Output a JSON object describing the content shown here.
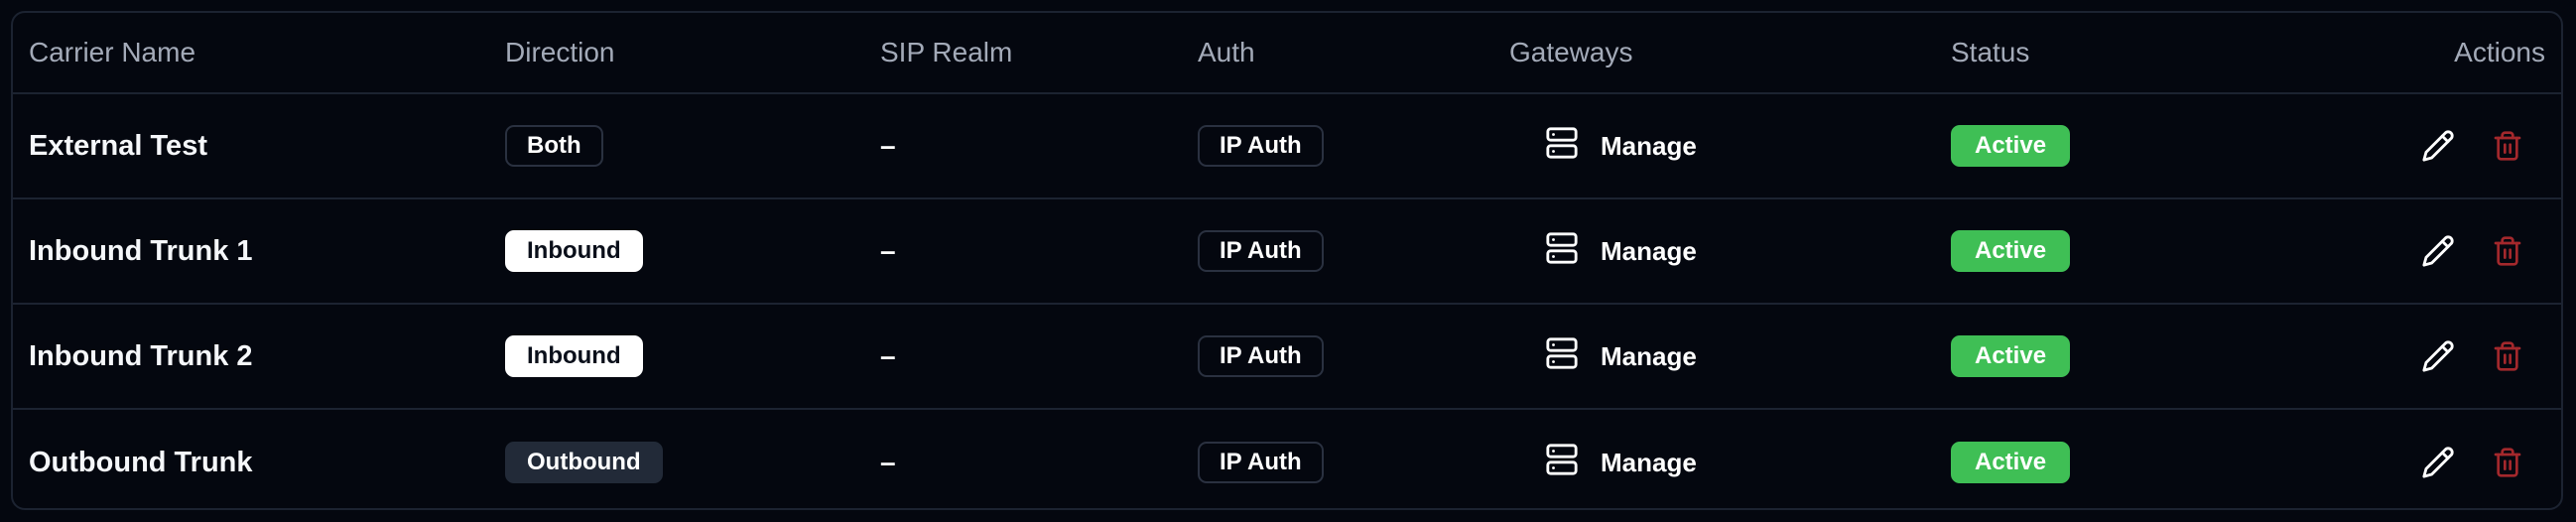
{
  "table": {
    "columns": {
      "name": "Carrier Name",
      "direction": "Direction",
      "sip_realm": "SIP Realm",
      "auth": "Auth",
      "gateways": "Gateways",
      "status": "Status",
      "actions": "Actions"
    },
    "rows": [
      {
        "name": "External Test",
        "direction": "Both",
        "sip_realm": "–",
        "auth": "IP Auth",
        "gateways_action": "Manage",
        "status": "Active"
      },
      {
        "name": "Inbound Trunk 1",
        "direction": "Inbound",
        "sip_realm": "–",
        "auth": "IP Auth",
        "gateways_action": "Manage",
        "status": "Active"
      },
      {
        "name": "Inbound Trunk 2",
        "direction": "Inbound",
        "sip_realm": "–",
        "auth": "IP Auth",
        "gateways_action": "Manage",
        "status": "Active"
      },
      {
        "name": "Outbound Trunk",
        "direction": "Outbound",
        "sip_realm": "–",
        "auth": "IP Auth",
        "gateways_action": "Manage",
        "status": "Active"
      }
    ]
  },
  "icons": {
    "gateways": "server-icon",
    "edit": "pencil-icon",
    "delete": "trash-icon"
  },
  "colors": {
    "background": "#04070f",
    "border": "#1c2331",
    "active": "#3fbf55",
    "delete": "#a3282c"
  }
}
